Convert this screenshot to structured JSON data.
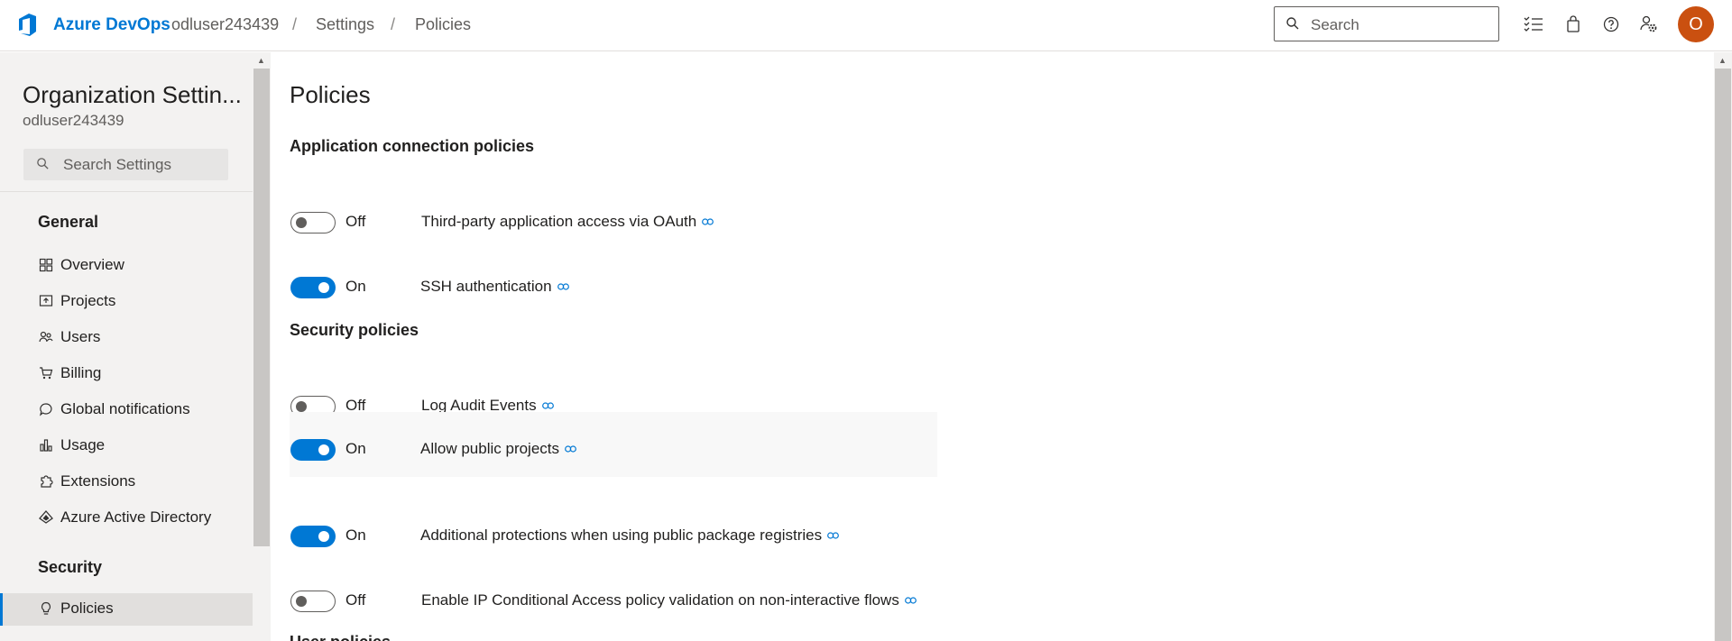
{
  "header": {
    "brand": "Azure DevOps",
    "breadcrumbs": [
      "odluser243439",
      "Settings",
      "Policies"
    ],
    "separator": "/",
    "search_placeholder": "Search",
    "avatar_initial": "O",
    "accent": "#0078d4",
    "avatar_color": "#ca5010"
  },
  "sidebar": {
    "title": "Organization Settin...",
    "subtitle": "odluser243439",
    "search_placeholder": "Search Settings",
    "groups": [
      {
        "label": "General",
        "items": [
          {
            "label": "Overview",
            "icon": "overview-icon"
          },
          {
            "label": "Projects",
            "icon": "projects-icon"
          },
          {
            "label": "Users",
            "icon": "users-icon"
          },
          {
            "label": "Billing",
            "icon": "cart-icon"
          },
          {
            "label": "Global notifications",
            "icon": "chat-icon"
          },
          {
            "label": "Usage",
            "icon": "usage-icon"
          },
          {
            "label": "Extensions",
            "icon": "puzzle-icon"
          },
          {
            "label": "Azure Active Directory",
            "icon": "aad-icon"
          }
        ]
      },
      {
        "label": "Security",
        "items": [
          {
            "label": "Policies",
            "icon": "lightbulb-icon",
            "selected": true
          }
        ]
      }
    ]
  },
  "main": {
    "title": "Policies",
    "sections": [
      {
        "title": "Application connection policies",
        "policies": [
          {
            "state": "Off",
            "label": "Third-party application access via OAuth"
          },
          {
            "state": "On",
            "label": "SSH authentication"
          }
        ]
      },
      {
        "title": "Security policies",
        "policies": [
          {
            "state": "Off",
            "label": "Log Audit Events"
          },
          {
            "state": "On",
            "label": "Allow public projects"
          },
          {
            "state": "On",
            "label": "Additional protections when using public package registries"
          },
          {
            "state": "Off",
            "label": "Enable IP Conditional Access policy validation on non-interactive flows"
          }
        ]
      }
    ],
    "next_section_partial": "User policies"
  }
}
